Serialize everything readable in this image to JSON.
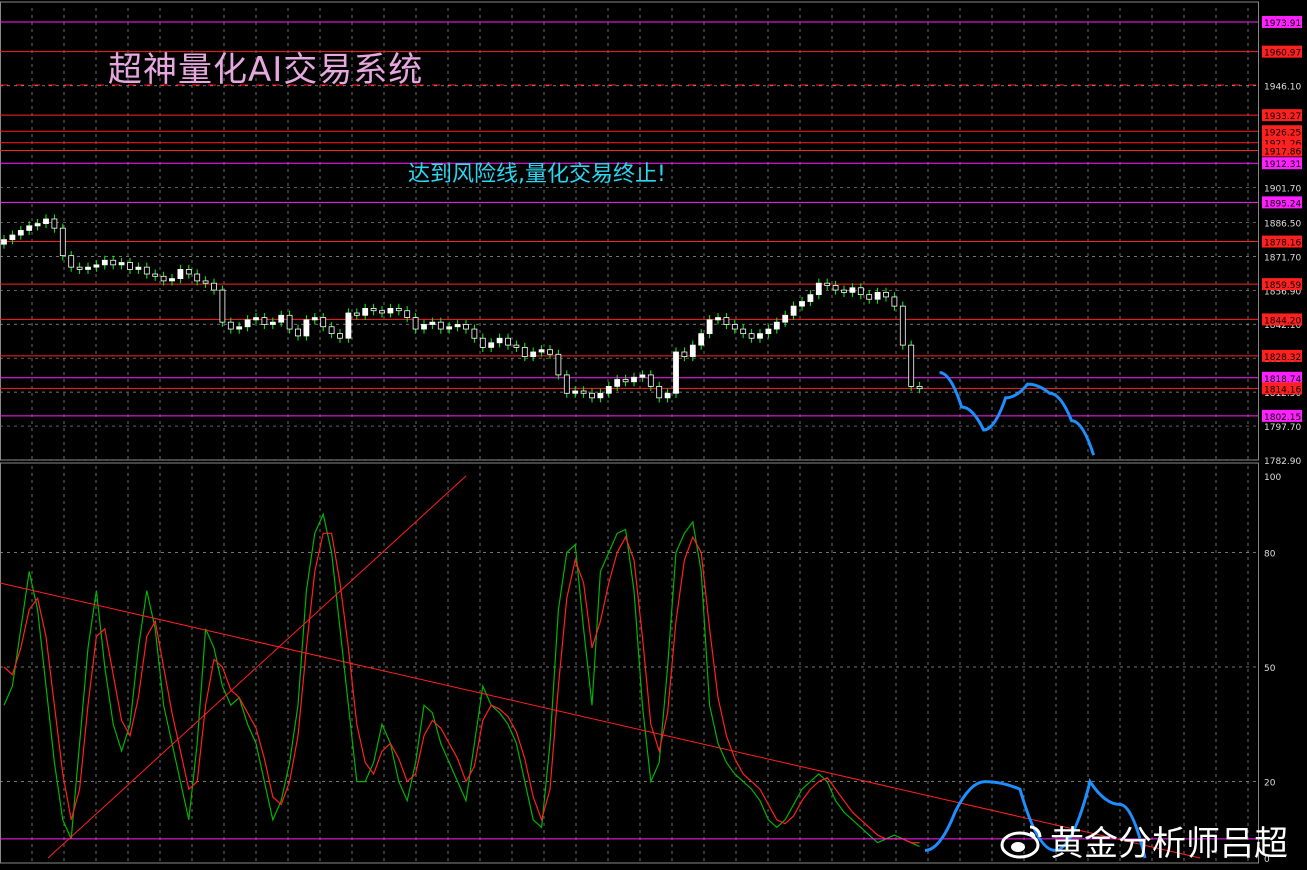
{
  "title": "超神量化AI交易系统",
  "notice": "达到风险线,量化交易终止!",
  "watermark": "黄金分析师吕超",
  "colors": {
    "background": "#000000",
    "grid": "#9a9a9a",
    "bull_candle": "#ffffff",
    "bear_candle": "#ffffff",
    "wick": "#00ff00",
    "red_level": "#ff2020",
    "magenta_level": "#ff20ff",
    "stoch_main": "#00b400",
    "stoch_signal": "#ff2020",
    "forecast": "#1e8fff"
  },
  "price_axis": {
    "min": 1782.9,
    "max": 1980,
    "ticks": [
      "1946.10",
      "1901.70",
      "1886.50",
      "1871.70",
      "1856.90",
      "1842.10",
      "1827.30",
      "1812.50",
      "1797.70",
      "1782.90"
    ]
  },
  "price_levels": [
    {
      "label": "1973.91",
      "value": 1973.91,
      "color": "magenta"
    },
    {
      "label": "1960.97",
      "value": 1960.97,
      "color": "red"
    },
    {
      "label": "1933.27",
      "value": 1933.27,
      "color": "red"
    },
    {
      "label": "1926.25",
      "value": 1926.25,
      "color": "red"
    },
    {
      "label": "1921.26",
      "value": 1921.26,
      "color": "red"
    },
    {
      "label": "1917.86",
      "value": 1917.86,
      "color": "red"
    },
    {
      "label": "1912.31",
      "value": 1912.31,
      "color": "magenta"
    },
    {
      "label": "1895.24",
      "value": 1895.24,
      "color": "magenta"
    },
    {
      "label": "1878.16",
      "value": 1878.16,
      "color": "red"
    },
    {
      "label": "1859.59",
      "value": 1859.59,
      "color": "red"
    },
    {
      "label": "1844.20",
      "value": 1844.2,
      "color": "red"
    },
    {
      "label": "1828.32",
      "value": 1828.32,
      "color": "red"
    },
    {
      "label": "1818.74",
      "value": 1818.74,
      "color": "magenta"
    },
    {
      "label": "1814.16",
      "value": 1814.16,
      "color": "red"
    },
    {
      "label": "1802.15",
      "value": 1802.15,
      "color": "magenta"
    }
  ],
  "oscillator_axis": {
    "min": 0,
    "max": 100,
    "ticks": [
      "100",
      "80",
      "50",
      "20",
      "0"
    ],
    "level_line": 5
  },
  "chart_data": {
    "type": "candlestick",
    "close": [
      1879,
      1881,
      1883,
      1885,
      1886,
      1888,
      1884,
      1872,
      1867,
      1866,
      1867,
      1868,
      1870,
      1868,
      1869,
      1866,
      1867,
      1864,
      1863,
      1861,
      1862,
      1866,
      1864,
      1861,
      1860,
      1857,
      1843,
      1840,
      1841,
      1844,
      1845,
      1842,
      1843,
      1846,
      1840,
      1837,
      1844,
      1845,
      1841,
      1838,
      1836,
      1847,
      1846,
      1849,
      1848,
      1847,
      1849,
      1848,
      1845,
      1840,
      1842,
      1843,
      1840,
      1841,
      1842,
      1840,
      1836,
      1832,
      1834,
      1836,
      1833,
      1832,
      1828,
      1830,
      1831,
      1829,
      1820,
      1812,
      1813,
      1812,
      1810,
      1812,
      1815,
      1818,
      1817,
      1819,
      1820,
      1815,
      1810,
      1812,
      1830,
      1828,
      1833,
      1838,
      1844,
      1845,
      1842,
      1840,
      1838,
      1836,
      1838,
      1840,
      1843,
      1846,
      1850,
      1852,
      1855,
      1860,
      1859,
      1857,
      1856,
      1858,
      1855,
      1853,
      1856,
      1854,
      1850,
      1833,
      1815,
      1814
    ],
    "forecast_path": [
      [
        0,
        1821
      ],
      [
        1,
        1806
      ],
      [
        2,
        1796
      ],
      [
        3,
        1810
      ],
      [
        4,
        1816
      ],
      [
        5,
        1812
      ],
      [
        6,
        1800
      ],
      [
        7,
        1785
      ]
    ],
    "stochastic_main": [
      40,
      45,
      60,
      75,
      65,
      45,
      25,
      10,
      5,
      30,
      55,
      70,
      50,
      35,
      28,
      35,
      55,
      70,
      60,
      40,
      30,
      20,
      10,
      30,
      60,
      55,
      45,
      40,
      42,
      35,
      30,
      20,
      10,
      15,
      25,
      40,
      70,
      85,
      90,
      80,
      60,
      40,
      20,
      20,
      25,
      35,
      30,
      20,
      15,
      25,
      40,
      38,
      30,
      25,
      20,
      15,
      30,
      45,
      40,
      38,
      35,
      30,
      20,
      10,
      8,
      30,
      65,
      80,
      82,
      60,
      40,
      75,
      80,
      85,
      86,
      70,
      40,
      20,
      25,
      50,
      80,
      85,
      88,
      75,
      40,
      30,
      25,
      22,
      20,
      18,
      15,
      10,
      8,
      10,
      14,
      18,
      20,
      22,
      20,
      15,
      12,
      10,
      8,
      6,
      4,
      5,
      6,
      5,
      4,
      3
    ],
    "stochastic_signal": [
      50,
      48,
      55,
      65,
      68,
      58,
      40,
      22,
      10,
      18,
      40,
      58,
      60,
      48,
      36,
      32,
      42,
      58,
      62,
      50,
      38,
      28,
      18,
      20,
      40,
      52,
      50,
      44,
      42,
      38,
      34,
      26,
      16,
      14,
      20,
      32,
      55,
      75,
      85,
      85,
      72,
      55,
      35,
      25,
      22,
      28,
      30,
      26,
      20,
      22,
      32,
      36,
      34,
      30,
      26,
      20,
      24,
      36,
      40,
      39,
      37,
      33,
      26,
      16,
      10,
      18,
      45,
      68,
      78,
      72,
      55,
      62,
      72,
      80,
      84,
      78,
      58,
      35,
      28,
      38,
      62,
      78,
      84,
      80,
      60,
      42,
      32,
      26,
      22,
      20,
      18,
      14,
      10,
      9,
      11,
      15,
      18,
      20,
      21,
      18,
      15,
      12,
      10,
      8,
      6,
      5,
      5,
      5,
      4,
      4
    ]
  }
}
